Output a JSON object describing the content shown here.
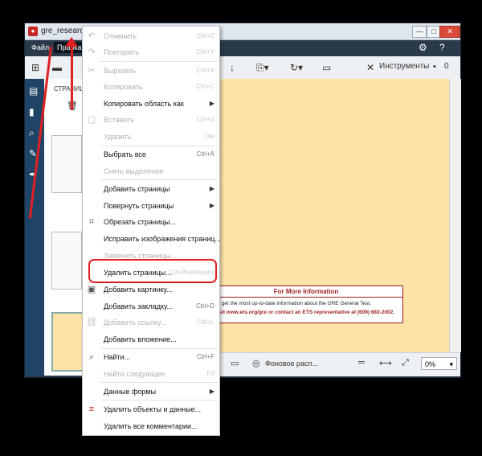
{
  "window": {
    "title": "gre_research_va",
    "min": "—",
    "max": "□",
    "close": "✕"
  },
  "menubar": {
    "file": "Файл",
    "edit": "Правка"
  },
  "toolbar": {
    "tools_label": "Инструменты",
    "comments_count": "0"
  },
  "pages_panel": {
    "header": "СТРАНИЦ"
  },
  "edit_menu": {
    "items": [
      {
        "label": "Отменить",
        "shortcut": "Ctrl+Z",
        "disabled": true
      },
      {
        "label": "Повторить",
        "shortcut": "Ctrl+Y",
        "disabled": true
      },
      {
        "label": "Вырезать",
        "shortcut": "Ctrl+X",
        "disabled": true
      },
      {
        "label": "Копировать",
        "shortcut": "Ctrl+C",
        "disabled": true
      },
      {
        "label": "Копировать область как",
        "submenu": true
      },
      {
        "label": "Вставить",
        "shortcut": "Ctrl+V",
        "disabled": true
      },
      {
        "label": "Удалить",
        "shortcut": "Del",
        "disabled": true
      },
      {
        "label": "Выбрать все",
        "shortcut": "Ctrl+A"
      },
      {
        "label": "Снять выделения",
        "disabled": true
      },
      {
        "label": "Добавить страницы",
        "submenu": true
      },
      {
        "label": "Повернуть страницы",
        "submenu": true
      },
      {
        "label": "Обрезать страницы..."
      },
      {
        "label": "Исправить изображения страниц..."
      },
      {
        "label": "Заменить страницы...",
        "disabled": true
      },
      {
        "label": "Удалить страницы...",
        "shortcut": "Ctrl+Backspace"
      },
      {
        "label": "Добавить картинку..."
      },
      {
        "label": "Добавить закладку...",
        "shortcut": "Ctrl+D"
      },
      {
        "label": "Добавить ссылку...",
        "shortcut": "Ctrl+L",
        "disabled": true
      },
      {
        "label": "Добавить вложение..."
      },
      {
        "label": "Найти...",
        "shortcut": "Ctrl+F"
      },
      {
        "label": "Найти следующее",
        "shortcut": "F3",
        "disabled": true
      },
      {
        "label": "Данные формы",
        "submenu": true
      },
      {
        "label": "Удалить объекты и данные..."
      },
      {
        "label": "Удалить все комментарии..."
      }
    ]
  },
  "document": {
    "box_title": "For More Information",
    "line1": "To get the most up-to-date information about the GRE General Test,",
    "line2": "visit www.ets.org/gre or contact an ETS representative at (609) 683-2002."
  },
  "statusbar": {
    "background_label": "Фоновое расп...",
    "zoom": "0%"
  },
  "colors": {
    "accent": "#e02020",
    "sidebar": "#1f4466",
    "document_bg": "#fde3a7"
  }
}
